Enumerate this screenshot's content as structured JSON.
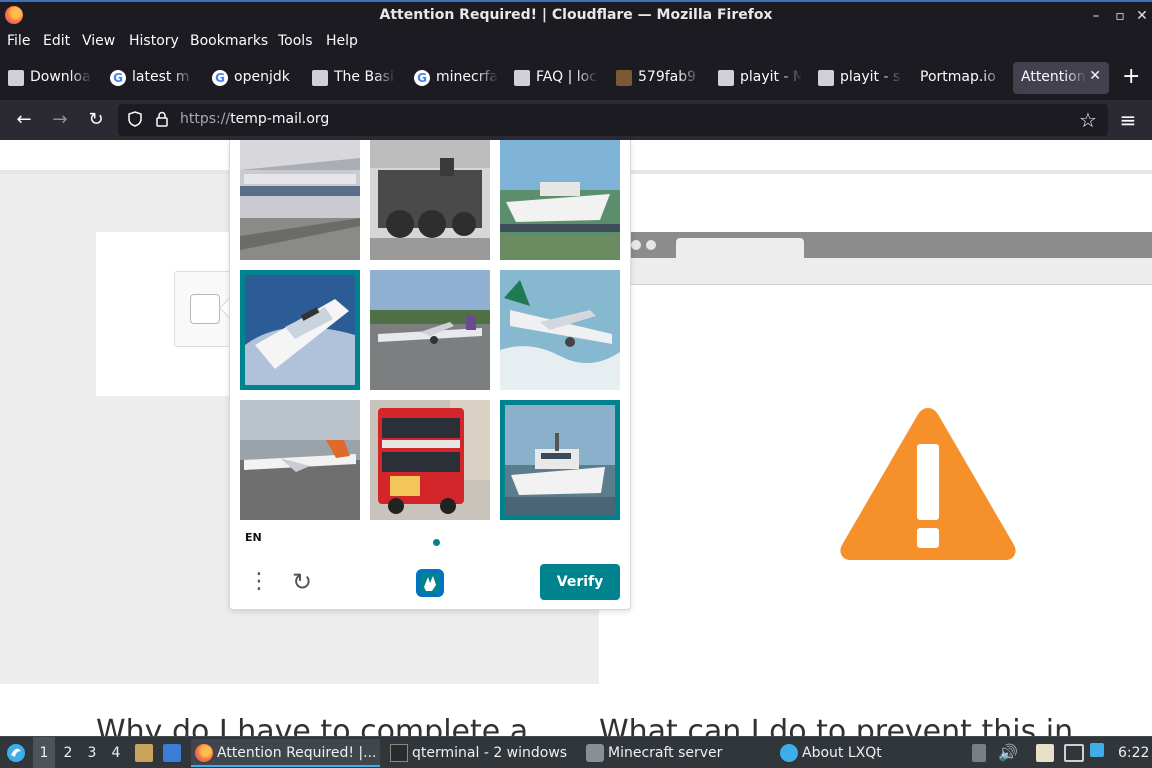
{
  "window": {
    "title": "Attention Required! | Cloudflare — Mozilla Firefox",
    "minimize": "–",
    "maximize": "▫",
    "close": "✕"
  },
  "menu": [
    "File",
    "Edit",
    "View",
    "History",
    "Bookmarks",
    "Tools",
    "Help"
  ],
  "tabs": [
    {
      "label": "Downloa",
      "icon": "page-icon"
    },
    {
      "label": "latest m",
      "icon": "google-icon"
    },
    {
      "label": "openjdk",
      "icon": "google-icon"
    },
    {
      "label": "The Basi",
      "icon": "page-icon"
    },
    {
      "label": "minecrfa",
      "icon": "google-icon"
    },
    {
      "label": "FAQ | loc",
      "icon": "page-icon"
    },
    {
      "label": "579fab9",
      "icon": "minecraft-icon"
    },
    {
      "label": "playit - M",
      "icon": "page-icon"
    },
    {
      "label": "playit - s",
      "icon": "page-icon"
    },
    {
      "label": "Portmap.io",
      "icon": "none"
    },
    {
      "label": "Attention",
      "icon": "none",
      "active": true
    }
  ],
  "tab_close": "✕",
  "new_tab": "+",
  "nav": {
    "back": "←",
    "forward": "→",
    "reload": "↻",
    "url_protocol": "https://",
    "url_host": "temp-mail.org",
    "star": "☆",
    "menu": "≡"
  },
  "page": {
    "heading_left": "Why do I have to complete a",
    "heading_right": "What can I do to prevent this in"
  },
  "captcha": {
    "tiles": [
      {
        "subject": "train"
      },
      {
        "subject": "steam-locomotive"
      },
      {
        "subject": "boat"
      },
      {
        "subject": "boat",
        "selected": true
      },
      {
        "subject": "airplane"
      },
      {
        "subject": "airplane"
      },
      {
        "subject": "airplane"
      },
      {
        "subject": "double-decker-bus"
      },
      {
        "subject": "boat",
        "selected": true
      }
    ],
    "language": "EN",
    "menu_icon": "⋮",
    "refresh_icon": "↻",
    "verify_label": "Verify",
    "accent": "#00838f"
  },
  "taskbar": {
    "workspaces": [
      "1",
      "2",
      "3",
      "4"
    ],
    "active_workspace": "1",
    "tasks": [
      {
        "label": "Attention Required! |...",
        "active": true
      },
      {
        "label": "qterminal - 2 windows"
      },
      {
        "label": "Minecraft server"
      },
      {
        "label": "About LXQt"
      }
    ],
    "clock": "6:22"
  },
  "colors": {
    "warning": "#f6902b",
    "taskbar": "#31363b",
    "firefox_chrome": "#1c1b22"
  }
}
